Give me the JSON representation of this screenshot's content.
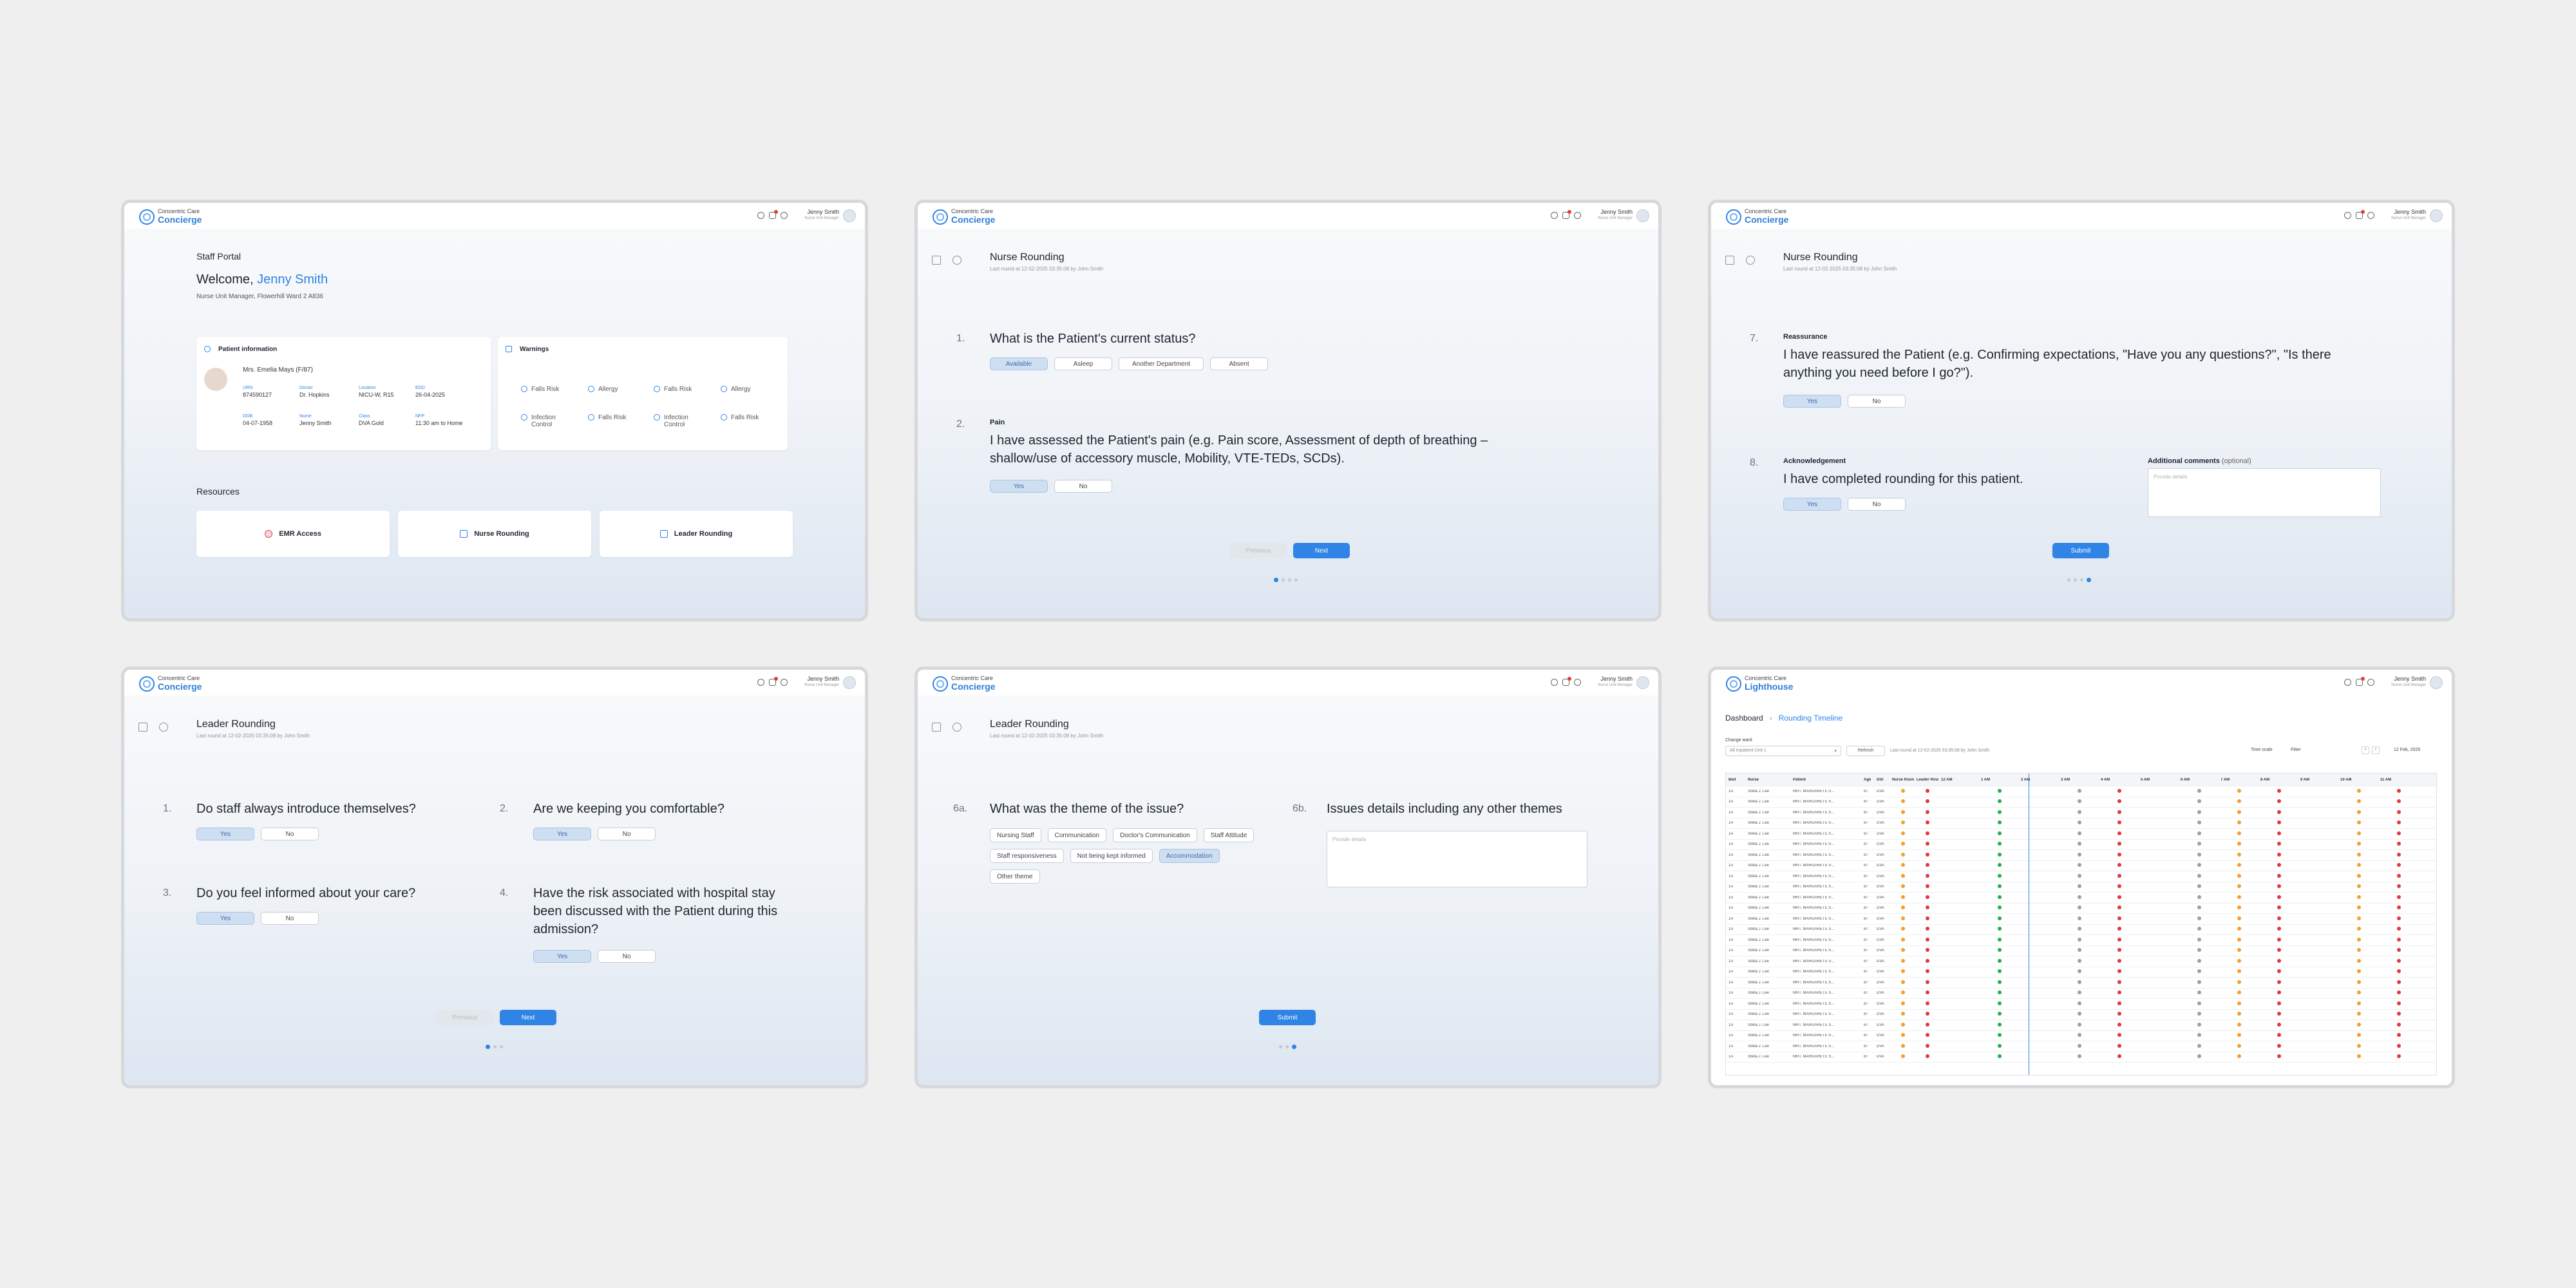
{
  "brand": {
    "company": "Concentric Care",
    "concierge": "Concierge",
    "lighthouse": "Lighthouse"
  },
  "user": {
    "name": "Jenny Smith",
    "role": "Nurse Unit Manager"
  },
  "portal": {
    "label": "Staff Portal",
    "welcome": "Welcome,",
    "name": "Jenny Smith",
    "subtitle": "Nurse Unit Manager, Flowerhill Ward 2 A836",
    "patient_title": "Patient information",
    "patient_name": "Mrs. Emelia Mays (F/87)",
    "fields": [
      {
        "k": "URN",
        "v": "874590127"
      },
      {
        "k": "Doctor",
        "v": "Dr. Hopkins"
      },
      {
        "k": "Location",
        "v": "NICU-W, R15"
      },
      {
        "k": "EDD",
        "v": "26-04-2025"
      },
      {
        "k": "DOB",
        "v": "04-07-1958"
      },
      {
        "k": "Nurse",
        "v": "Jenny Smith"
      },
      {
        "k": "Class",
        "v": "DVA Gold"
      },
      {
        "k": "NFP",
        "v": "11:30 am to Home"
      }
    ],
    "warnings_title": "Warnings",
    "warnings": [
      "Falls Risk",
      "Allergy",
      "Falls Risk",
      "Allergy",
      "Infection Control",
      "Falls Risk",
      "Infection Control",
      "Falls Risk"
    ],
    "resources_title": "Resources",
    "resources": [
      "EMR Access",
      "Nurse Rounding",
      "Leader Rounding"
    ]
  },
  "nurse": {
    "title": "Nurse Rounding",
    "last": "Last round at 12-02-2025 03:35:08 by John Smith",
    "q1": {
      "num": "1.",
      "text": "What is the Patient's current status?",
      "options": [
        "Available",
        "Asleep",
        "Another Department",
        "Absent"
      ]
    },
    "q2": {
      "num": "2.",
      "label": "Pain",
      "text": "I have assessed the Patient's pain (e.g. Pain score, Assessment of depth of breathing – shallow/use of accessory muscle, Mobility, VTE-TEDs, SCDs)."
    },
    "q7": {
      "num": "7.",
      "label": "Reassurance",
      "text": "I have reassured the Patient (e.g. Confirming expectations, \"Have you any questions?\", \"Is there anything you need before I go?\")."
    },
    "q8": {
      "num": "8.",
      "label": "Acknowledgement",
      "text": "I have completed rounding for this patient."
    },
    "comments_label": "Additional comments",
    "comments_optional": "(optional)",
    "placeholder": "Provide details"
  },
  "leader": {
    "title": "Leader Rounding",
    "last": "Last round at 12-02-2025 03:35:08 by John Smith",
    "q1": {
      "num": "1.",
      "text": "Do staff always introduce themselves?"
    },
    "q2": {
      "num": "2.",
      "text": "Are we keeping you comfortable?"
    },
    "q3": {
      "num": "3.",
      "text": "Do you feel informed about your care?"
    },
    "q4": {
      "num": "4.",
      "text": "Have the risk associated with hospital stay been discussed with the Patient during this admission?"
    },
    "q6a": {
      "num": "6a.",
      "text": "What was the theme of the issue?",
      "options": [
        "Nursing Staff",
        "Communication",
        "Doctor's Communication",
        "Staff Attitude",
        "Staff responsiveness",
        "Not being kept informed",
        "Accommodation",
        "Other theme"
      ]
    },
    "q6b": {
      "num": "6b.",
      "text": "Issues details including any other themes"
    }
  },
  "common": {
    "yes": "Yes",
    "no": "No",
    "previous": "Previous",
    "next": "Next",
    "submit": "Submit"
  },
  "dashboard": {
    "crumb1": "Dashboard",
    "crumb2": "Rounding Timeline",
    "change_ward": "Change ward",
    "ward_value": "All Inpatient Unit 1",
    "refresh": "Refresh",
    "last_round": "Last round at 12-02-2025 03:35:08 by John Smith",
    "timescale": "Time scale",
    "filter": "Filter",
    "date": "12 Feb, 2025",
    "headers": [
      "Bed",
      "Nurse",
      "Patient",
      "Age",
      "DSt",
      "Nurse Rounding",
      "Leader Rounding",
      "12 AM",
      "1 AM",
      "2 AM",
      "3 AM",
      "4 AM",
      "5 AM",
      "6 AM",
      "7 AM",
      "8 AM",
      "9 AM",
      "10 AM",
      "11 AM"
    ],
    "row": {
      "bed": "1A",
      "nurse": "Stella J. Lee",
      "patient": "MRT. MARGARETE S...",
      "age": "87",
      "dst": "DVA"
    }
  },
  "colors": {
    "accent": "#2f84e6",
    "green": "#23b04a",
    "orange": "#f0a030",
    "red": "#e03a3a",
    "grey": "#9aa0a8"
  }
}
